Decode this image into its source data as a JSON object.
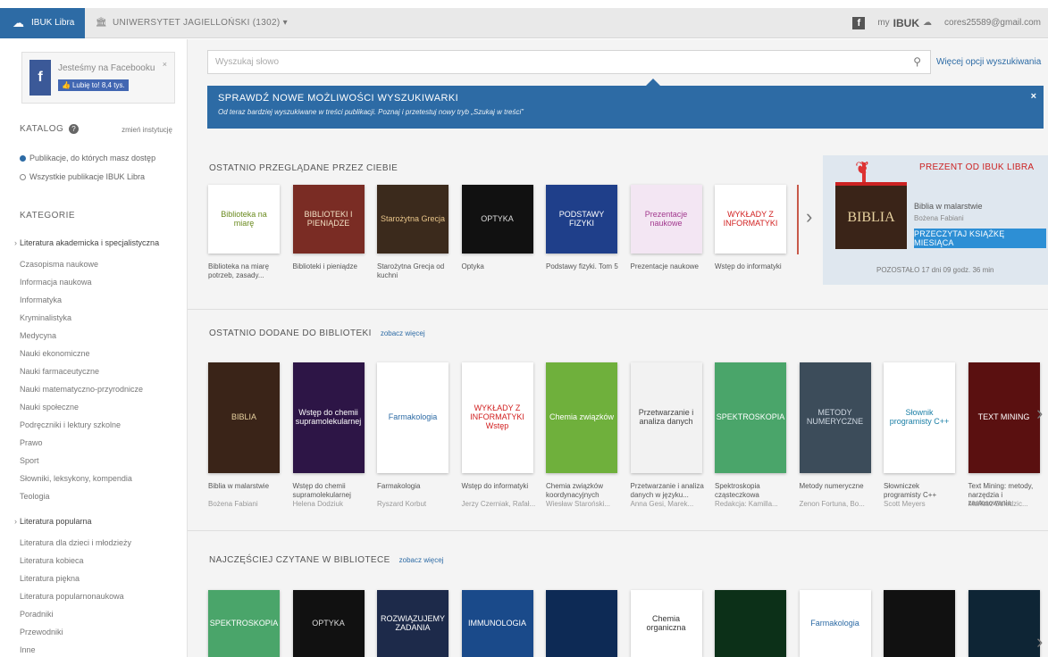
{
  "topbar": {
    "brand": "IBUK Libra",
    "university": "UNIWERSYTET JAGIELLOŃSKI (1302) ▾",
    "fb": "f",
    "mybook_label": "my",
    "mybook_brand": "IBUK",
    "email": "cores25589@gmail.com"
  },
  "sidebar": {
    "fb_text": "Jesteśmy na Facebooku",
    "fb_like": "Lubię to! 8,4 tys.",
    "fb_close": "×",
    "catalog_title": "KATALOG",
    "catalog_link": "zmień instytucję",
    "radio1": "Publikacje, do których masz dostęp",
    "radio2": "Wszystkie publikacje IBUK Libra",
    "categories_title": "KATEGORIE",
    "categories": [
      {
        "label": "Literatura akademicka i specjalistyczna",
        "head": true
      },
      {
        "label": "Czasopisma naukowe",
        "head": false
      },
      {
        "label": "Informacja naukowa",
        "head": false
      },
      {
        "label": "Informatyka",
        "head": false
      },
      {
        "label": "Kryminalistyka",
        "head": false
      },
      {
        "label": "Medycyna",
        "head": false
      },
      {
        "label": "Nauki ekonomiczne",
        "head": false
      },
      {
        "label": "Nauki farmaceutyczne",
        "head": false
      },
      {
        "label": "Nauki matematyczno-przyrodnicze",
        "head": false
      },
      {
        "label": "Nauki społeczne",
        "head": false
      },
      {
        "label": "Podręczniki i lektury szkolne",
        "head": false
      },
      {
        "label": "Prawo",
        "head": false
      },
      {
        "label": "Sport",
        "head": false
      },
      {
        "label": "Słowniki, leksykony, kompendia",
        "head": false
      },
      {
        "label": "Teologia",
        "head": false
      },
      {
        "label": "Literatura popularna",
        "head": true
      },
      {
        "label": "Literatura dla dzieci i młodzieży",
        "head": false
      },
      {
        "label": "Literatura kobieca",
        "head": false
      },
      {
        "label": "Literatura piękna",
        "head": false
      },
      {
        "label": "Literatura popularnonaukowa",
        "head": false
      },
      {
        "label": "Poradniki",
        "head": false
      },
      {
        "label": "Przewodniki",
        "head": false
      },
      {
        "label": "Inne",
        "head": false
      }
    ]
  },
  "search": {
    "placeholder": "Wyszukaj słowo",
    "more_options": "Więcej opcji wyszukiwania"
  },
  "banner": {
    "title": "SPRAWDŹ NOWE MOŻLIWOŚCI WYSZUKIWARKI",
    "text": "Od teraz bardziej wyszukiwane w treści publikacji. Poznaj i przetestuj nowy tryb „Szukaj w treści”",
    "close": "×"
  },
  "shelf_recent": {
    "title": "OSTATNIO PRZEGLĄDANE PRZEZ CIEBIE",
    "books": [
      {
        "cover": "Biblioteka na miarę",
        "title": "Biblioteka na miarę potrzeb, zasady...",
        "bg": "#ffffff",
        "fg": "#6a8a1e"
      },
      {
        "cover": "BIBLIOTEKI I PIENIĄDZE",
        "title": "Biblioteki i pieniądze",
        "bg": "#7a2c24",
        "fg": "#f1e0c4"
      },
      {
        "cover": "Starożytna Grecja",
        "title": "Starożytna Grecja od kuchni",
        "bg": "#3b2a1c",
        "fg": "#e8c58a"
      },
      {
        "cover": "OPTYKA",
        "title": "Optyka",
        "bg": "#111111",
        "fg": "#dddddd"
      },
      {
        "cover": "PODSTAWY FIZYKI",
        "title": "Podstawy fizyki. Tom 5",
        "bg": "#1f3f8a",
        "fg": "#ffffff"
      },
      {
        "cover": "Prezentacje naukowe",
        "title": "Prezentacje naukowe",
        "bg": "#f3e6f3",
        "fg": "#a2398e"
      },
      {
        "cover": "WYKŁADY Z INFORMATYKI",
        "title": "Wstęp do informatyki",
        "bg": "#ffffff",
        "fg": "#d11f1f"
      }
    ]
  },
  "gift": {
    "title": "PREZENT OD IBUK LIBRA",
    "cover": "BIBLIA",
    "book": "Biblia w malarstwie",
    "author": "Bożena Fabiani",
    "button": "PRZECZYTAJ KSIĄŻKĘ MIESIĄCA",
    "timer": "POZOSTAŁO 17 dni 09 godz. 36 min"
  },
  "shelf_added": {
    "title": "OSTATNIO DODANE DO BIBLIOTEKI",
    "more": "zobacz więcej",
    "books": [
      {
        "cover": "BIBLIA",
        "title": "Biblia w malarstwie",
        "author": "Bożena Fabiani",
        "bg": "#3a2418",
        "fg": "#e8d2a0"
      },
      {
        "cover": "Wstęp do chemii supramolekularnej",
        "title": "Wstęp do chemii supramolekularnej",
        "author": "Helena Dodziuk",
        "bg": "#2d1546",
        "fg": "#ffffff"
      },
      {
        "cover": "Farmakologia",
        "title": "Farmakologia",
        "author": "Ryszard Korbut",
        "bg": "#ffffff",
        "fg": "#2d6ba5"
      },
      {
        "cover": "WYKŁADY Z INFORMATYKI Wstęp",
        "title": "Wstęp do informatyki",
        "author": "Jerzy Czerniak, Rafał...",
        "bg": "#ffffff",
        "fg": "#d11f1f"
      },
      {
        "cover": "Chemia związków",
        "title": "Chemia związków koordynacyjnych",
        "author": "Wiesław Staroński...",
        "bg": "#6fb03c",
        "fg": "#ffffff"
      },
      {
        "cover": "Przetwarzanie i analiza danych",
        "title": "Przetwarzanie i analiza danych w języku...",
        "author": "Anna Gesi, Marek...",
        "bg": "#f2f2f2",
        "fg": "#444444"
      },
      {
        "cover": "SPEKTROSKOPIA",
        "title": "Spektroskopia cząsteczkowa",
        "author": "Redakcja: Kamilla...",
        "bg": "#4aa56a",
        "fg": "#ffffff"
      },
      {
        "cover": "METODY NUMERYCZNE",
        "title": "Metody numeryczne",
        "author": "Zenon Fortuna, Bo...",
        "bg": "#3c4c5a",
        "fg": "#cfd8e2"
      },
      {
        "cover": "Słownik programisty C++",
        "title": "Słowniczek programisty C++",
        "author": "Scott Meyers",
        "bg": "#ffffff",
        "fg": "#1b7fa6"
      },
      {
        "cover": "TEXT MINING",
        "title": "Text Mining: metody, narzędzia i zastosowania",
        "author": "Mariusz Dziedzic...",
        "bg": "#5a1010",
        "fg": "#ffffff"
      }
    ]
  },
  "shelf_popular": {
    "title": "NAJCZĘŚCIEJ CZYTANE W BIBLIOTECE",
    "more": "zobacz więcej",
    "books": [
      {
        "cover": "SPEKTROSKOPIA",
        "bg": "#4aa56a",
        "fg": "#ffffff"
      },
      {
        "cover": "OPTYKA",
        "bg": "#111111",
        "fg": "#dddddd"
      },
      {
        "cover": "ROZWIĄZUJEMY ZADANIA",
        "bg": "#1d2a4a",
        "fg": "#ffffff"
      },
      {
        "cover": "IMMUNOLOGIA",
        "bg": "#1a4a8a",
        "fg": "#ffffff"
      },
      {
        "cover": "",
        "bg": "#0d2a55",
        "fg": "#ffffff"
      },
      {
        "cover": "Chemia organiczna",
        "bg": "#ffffff",
        "fg": "#333333"
      },
      {
        "cover": "",
        "bg": "#0c3018",
        "fg": "#ffffff"
      },
      {
        "cover": "Farmakologia",
        "bg": "#ffffff",
        "fg": "#2d6ba5"
      },
      {
        "cover": "",
        "bg": "#111111",
        "fg": "#ffffff"
      },
      {
        "cover": "",
        "bg": "#0e2535",
        "fg": "#ffffff"
      }
    ]
  }
}
